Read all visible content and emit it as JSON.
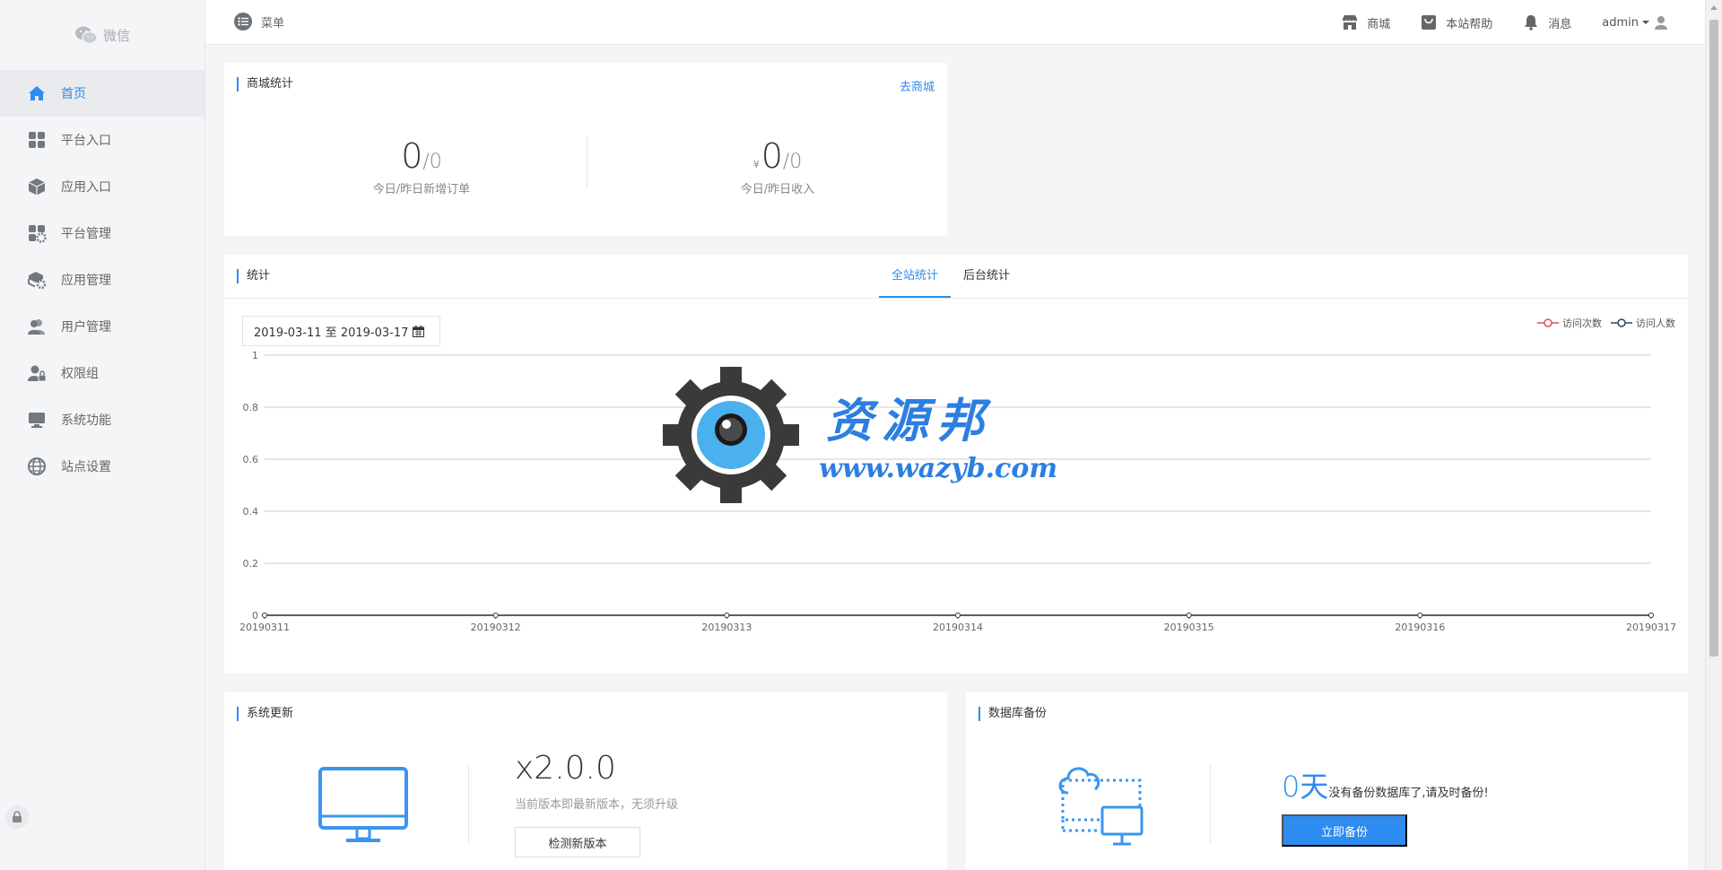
{
  "sidebar": {
    "brand": "微信",
    "items": [
      {
        "label": "首页",
        "icon": "home-icon",
        "active": true
      },
      {
        "label": "平台入口",
        "icon": "grid-icon"
      },
      {
        "label": "应用入口",
        "icon": "box-icon"
      },
      {
        "label": "平台管理",
        "icon": "grid-gear-icon"
      },
      {
        "label": "应用管理",
        "icon": "box-gear-icon"
      },
      {
        "label": "用户管理",
        "icon": "users-icon"
      },
      {
        "label": "权限组",
        "icon": "user-lock-icon"
      },
      {
        "label": "系统功能",
        "icon": "monitor-icon"
      },
      {
        "label": "站点设置",
        "icon": "globe-icon"
      }
    ]
  },
  "header": {
    "menu_label": "菜单",
    "links": [
      {
        "label": "商城",
        "icon": "store-icon"
      },
      {
        "label": "本站帮助",
        "icon": "bag-icon"
      },
      {
        "label": "消息",
        "icon": "bell-icon"
      }
    ],
    "user": "admin"
  },
  "shop_stats": {
    "title": "商城统计",
    "link": "去商城",
    "orders": {
      "today": "0",
      "yesterday": "/0",
      "label": "今日/昨日新增订单"
    },
    "revenue": {
      "currency": "¥",
      "today": "0",
      "yesterday": "/0",
      "label": "今日/昨日收入"
    }
  },
  "stats": {
    "title": "统计",
    "tabs": [
      "全站统计",
      "后台统计"
    ],
    "date_range": "2019-03-11 至 2019-03-17",
    "legend": [
      "访问次数",
      "访问人数"
    ]
  },
  "chart_data": {
    "type": "line",
    "x": [
      "20190311",
      "20190312",
      "20190313",
      "20190314",
      "20190315",
      "20190316",
      "20190317"
    ],
    "series": [
      {
        "name": "访问次数",
        "values": [
          0,
          0,
          0,
          0,
          0,
          0,
          0
        ],
        "color": "#e05050"
      },
      {
        "name": "访问人数",
        "values": [
          0,
          0,
          0,
          0,
          0,
          0,
          0
        ],
        "color": "#2f4554"
      }
    ],
    "yticks": [
      "0",
      "0.2",
      "0.4",
      "0.6",
      "0.8",
      "1"
    ],
    "ylim": [
      0,
      1
    ],
    "legend_position": "top-right",
    "grid": true
  },
  "update": {
    "title": "系统更新",
    "version": "x2.0.0",
    "desc": "当前版本即最新版本，无须升级",
    "button": "检测新版本"
  },
  "backup": {
    "title": "数据库备份",
    "days": "0天",
    "message": "没有备份数据库了,请及时备份!",
    "button": "立即备份"
  },
  "watermark": {
    "title": "资源邦",
    "url": "www.wazyb.com"
  },
  "colors": {
    "accent": "#2d8cf0",
    "sidebar_bg": "#f4f5f7"
  }
}
